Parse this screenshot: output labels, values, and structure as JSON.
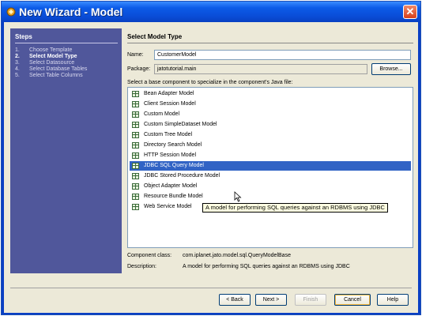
{
  "window": {
    "title": "New Wizard - Model"
  },
  "steps": {
    "title": "Steps",
    "items": [
      {
        "num": "1.",
        "label": "Choose Template"
      },
      {
        "num": "2.",
        "label": "Select Model Type"
      },
      {
        "num": "3.",
        "label": "Select Datasource"
      },
      {
        "num": "4.",
        "label": "Select Database Tables"
      },
      {
        "num": "5.",
        "label": "Select Table Columns"
      }
    ]
  },
  "main": {
    "title": "Select Model Type",
    "name_label": "Name:",
    "name_value": "CustomerModel",
    "package_label": "Package:",
    "package_value": "jatotutorial.main",
    "browse_label": "Browse...",
    "list_caption": "Select a base component to specialize in the component's Java file:",
    "components": [
      "Bean Adapter Model",
      "Client Session Model",
      "Custom Model",
      "Custom SimpleDataset Model",
      "Custom Tree Model",
      "Directory Search Model",
      "HTTP Session Model",
      "JDBC SQL Query Model",
      "JDBC Stored Procedure Model",
      "Object Adapter Model",
      "Resource Bundle Model",
      "Web Service Model"
    ],
    "selected_index": 7,
    "tooltip": "A model for performing SQL queries against an RDBMS using JDBC",
    "component_class_label": "Component class:",
    "component_class_value": "com.iplanet.jato.model.sql.QueryModelBase",
    "description_label": "Description:",
    "description_value": "A model for performing SQL queries against an RDBMS using JDBC"
  },
  "buttons": {
    "back": "< Back",
    "next": "Next >",
    "finish": "Finish",
    "cancel": "Cancel",
    "help": "Help"
  },
  "colors": {
    "titlebar": "#0a4dd8",
    "steps_panel": "#50579b",
    "selection": "#3163c5",
    "tooltip_bg": "#ffffe1"
  }
}
